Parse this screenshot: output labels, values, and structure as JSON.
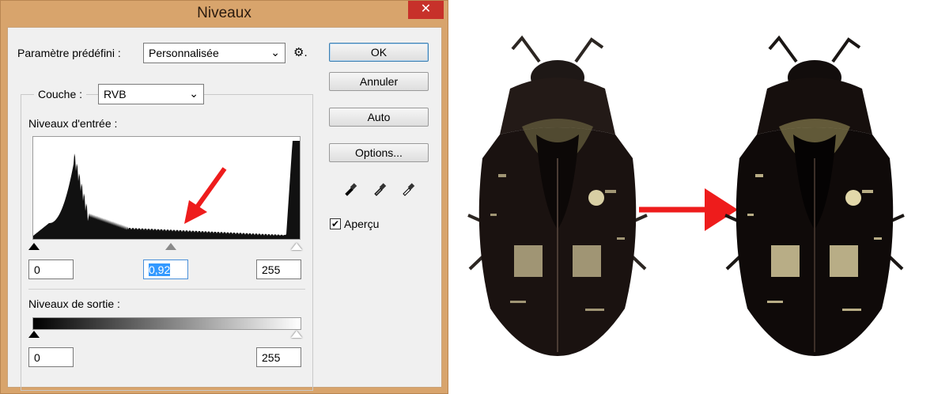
{
  "window": {
    "title": "Niveaux",
    "close_glyph": "✕"
  },
  "preset": {
    "label": "Paramètre prédéfini :",
    "value": "Personnalisée",
    "menu_glyph": "⚙."
  },
  "channel": {
    "label": "Couche :",
    "value": "RVB"
  },
  "input_levels": {
    "label": "Niveaux d'entrée :",
    "black": "0",
    "gamma": "0,92",
    "white": "255"
  },
  "output_levels": {
    "label": "Niveaux de sortie :",
    "black": "0",
    "white": "255"
  },
  "buttons": {
    "ok": "OK",
    "cancel": "Annuler",
    "auto": "Auto",
    "options": "Options..."
  },
  "preview": {
    "label": "Aperçu",
    "checked": true,
    "check_glyph": "✔"
  },
  "colors": {
    "annotation_arrow": "#ee1c1c",
    "window_frame": "#d8a46c",
    "close_button": "#c7312a",
    "histogram": "#111111",
    "selection": "#3399ff"
  }
}
